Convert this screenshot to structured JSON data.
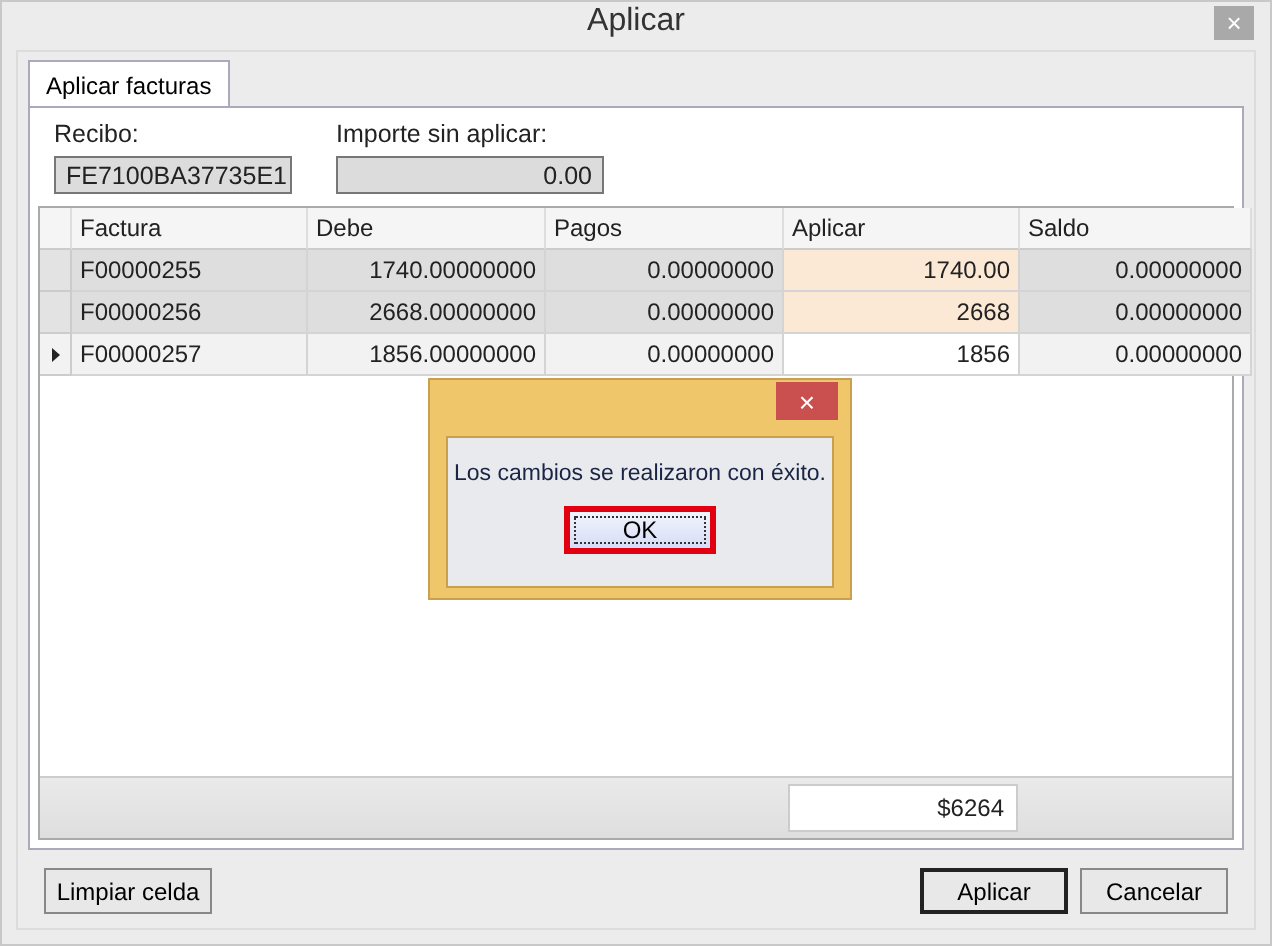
{
  "window": {
    "title": "Aplicar",
    "close": "×"
  },
  "tabs": [
    {
      "label": "Aplicar facturas",
      "selected": true
    }
  ],
  "recibo": {
    "label": "Recibo:",
    "value": "FE7100BA37735E1"
  },
  "importe": {
    "label": "Importe sin aplicar:",
    "value": "0.00"
  },
  "table": {
    "columns": [
      "Factura",
      "Debe",
      "Pagos",
      "Aplicar",
      "Saldo"
    ],
    "rows": [
      {
        "selected": false,
        "cells": [
          "F00000255",
          "1740.00000000",
          "0.00000000",
          "1740.00",
          "0.00000000"
        ]
      },
      {
        "selected": false,
        "cells": [
          "F00000256",
          "2668.00000000",
          "0.00000000",
          "2668",
          "0.00000000"
        ]
      },
      {
        "selected": true,
        "cells": [
          "F00000257",
          "1856.00000000",
          "0.00000000",
          "1856",
          "0.00000000"
        ]
      }
    ],
    "total": "$6264"
  },
  "dialog": {
    "close": "×",
    "message": "Los cambios se realizaron con éxito.",
    "button": "OK"
  },
  "buttons": {
    "clear": "Limpiar celda",
    "apply": "Aplicar",
    "cancel": "Cancelar"
  }
}
